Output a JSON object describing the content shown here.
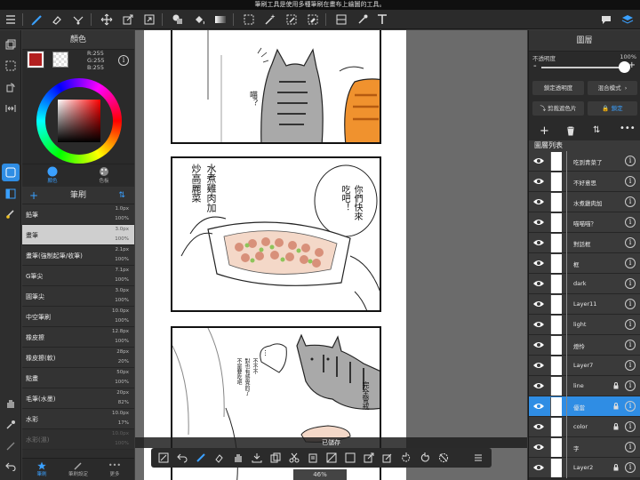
{
  "hint_text": "筆刷工具是使用多種筆刷在畫布上繪圖的工具。",
  "color_panel": {
    "title": "顏色",
    "rgb": {
      "r": "R:255",
      "g": "G:255",
      "b": "B:255"
    },
    "tabs": [
      {
        "label": "顏色"
      },
      {
        "label": "色板"
      }
    ],
    "foreground_color": "#b32020"
  },
  "brush_panel": {
    "title": "筆刷",
    "items": [
      {
        "name": "鉛筆",
        "size": "1.0px",
        "opacity": "100%"
      },
      {
        "name": "畫筆",
        "size": "3.0px",
        "opacity": "100%"
      },
      {
        "name": "畫筆(強制起筆/收筆)",
        "size": "2.1px",
        "opacity": "100%"
      },
      {
        "name": "G筆尖",
        "size": "7.1px",
        "opacity": "100%"
      },
      {
        "name": "圓筆尖",
        "size": "3.0px",
        "opacity": "100%"
      },
      {
        "name": "中空筆刷",
        "size": "10.0px",
        "opacity": "100%"
      },
      {
        "name": "橡皮擦",
        "size": "12.8px",
        "opacity": "100%"
      },
      {
        "name": "橡皮擦(軟)",
        "size": "28px",
        "opacity": "20%"
      },
      {
        "name": "點畫",
        "size": "50px",
        "opacity": "100%"
      },
      {
        "name": "毛筆(水墨)",
        "size": "20px",
        "opacity": "82%"
      },
      {
        "name": "水彩",
        "size": "10.0px",
        "opacity": "17%"
      },
      {
        "name": "水彩(濕)",
        "size": "10.0px",
        "opacity": "100%"
      }
    ],
    "selected_index": 1
  },
  "bottom_tabs": [
    {
      "label": "筆刷"
    },
    {
      "label": "筆刷設定"
    },
    {
      "label": "更多"
    }
  ],
  "canvas": {
    "saved_toast": "已儲存",
    "zoom": "46%",
    "manga_text": {
      "cat_meow": "喵？",
      "boiled_chicken": "水煮雞肉加",
      "fried_veg": "炒高麗菜",
      "come_eat": "你們快來",
      "eat": "吃吧！",
      "bubble2": "…",
      "not_this": "不不不\n對也有感覺的了\n不是要吃吧",
      "alert": "完全警戒"
    }
  },
  "layer_panel": {
    "title": "圖層",
    "opacity_label": "不透明度",
    "opacity_value": "100%",
    "opacity_fraction": 1.0,
    "lock_alpha": "鎖定透明度",
    "blend_mode": "混合模式",
    "clipping": "剪裁遮色片",
    "lock": "鎖定",
    "list_title": "圖層列表",
    "layers": [
      {
        "name": "吃到青菜了",
        "locked": false,
        "selected": false
      },
      {
        "name": "不好意思",
        "locked": false,
        "selected": false
      },
      {
        "name": "水煮雞肉加",
        "locked": false,
        "selected": false
      },
      {
        "name": "喵喵喵？",
        "locked": false,
        "selected": false
      },
      {
        "name": "對話框",
        "locked": false,
        "selected": false
      },
      {
        "name": "框",
        "locked": false,
        "selected": false
      },
      {
        "name": "dark",
        "locked": false,
        "selected": false
      },
      {
        "name": "Layer11",
        "locked": false,
        "selected": false
      },
      {
        "name": "light",
        "locked": false,
        "selected": false
      },
      {
        "name": "燈怜",
        "locked": false,
        "selected": false
      },
      {
        "name": "Layer7",
        "locked": false,
        "selected": false
      },
      {
        "name": "line",
        "locked": true,
        "selected": false
      },
      {
        "name": "優當",
        "locked": true,
        "selected": true
      },
      {
        "name": "color",
        "locked": true,
        "selected": false
      },
      {
        "name": "字",
        "locked": false,
        "selected": false
      },
      {
        "name": "Layer2",
        "locked": true,
        "selected": false
      }
    ]
  },
  "colors": {
    "accent": "#2f8de4",
    "panel": "#2a2a2a",
    "canvas_bg": "#6b6b6b"
  }
}
